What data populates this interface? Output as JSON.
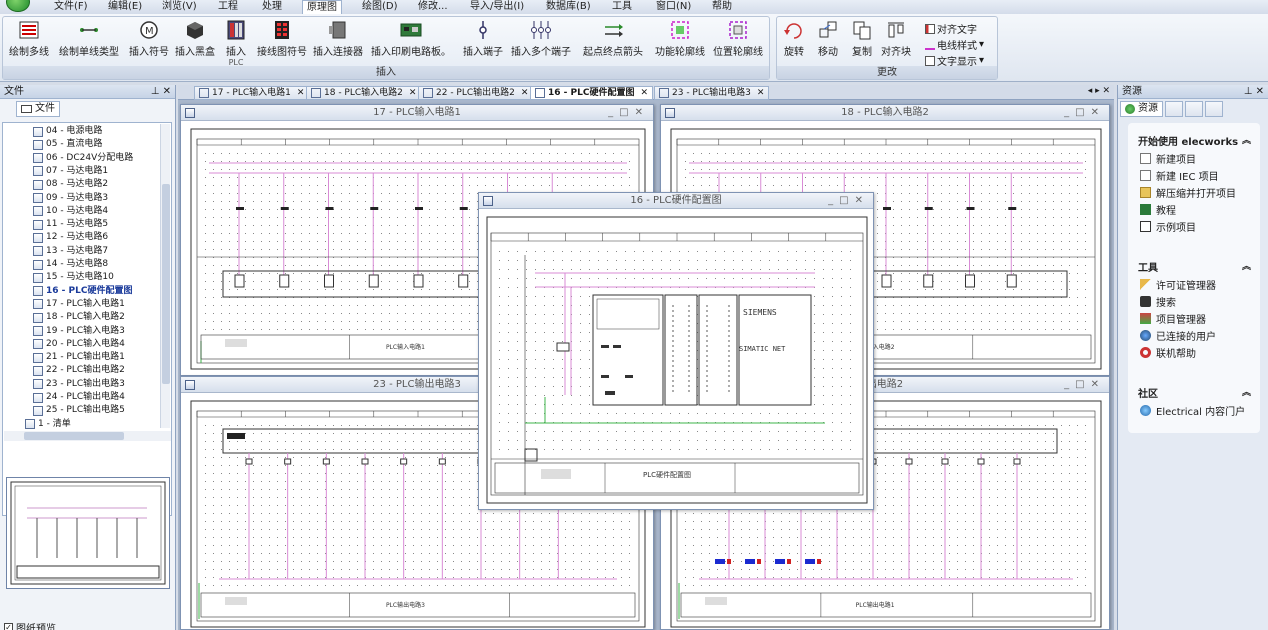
{
  "menu": {
    "items": [
      "文件(F)",
      "编辑(E)",
      "浏览(V)",
      "工程",
      "处理",
      "原理图",
      "绘图(D)",
      "修改...",
      "导入/导出(I)",
      "数据库(B)",
      "工具",
      "窗口(N)",
      "帮助"
    ],
    "active": "原理图"
  },
  "ribbon": {
    "buttons": {
      "draw_multiline": "绘制多线",
      "draw_singleline": "绘制单线类型",
      "insert_symbol": "插入符号",
      "insert_blackbox": "插入黑盒",
      "insert_plc": "插入",
      "insert_plc_sub": "PLC",
      "wiring_symbol": "接线图符号",
      "insert_connector": "插入连接器",
      "insert_pcb": "插入印刷电路板。",
      "insert_terminal": "插入端子",
      "insert_multi_terminal": "插入多个端子",
      "origin_dest_arrow": "起点终点箭头",
      "function_outline": "功能轮廓线",
      "location_outline": "位置轮廓线",
      "rotate": "旋转",
      "move": "移动",
      "copy": "复制",
      "align_block": "对齐块",
      "align_text": "对齐文字",
      "wire_style": "电线样式",
      "text_display": "文字显示"
    },
    "group_insert": "插入",
    "group_modify": "更改"
  },
  "left_panel": {
    "title": "文件",
    "tab": "文件",
    "tree_items": [
      {
        "label": "04 - 电源电路",
        "bold": false
      },
      {
        "label": "05 - 直流电路",
        "bold": false
      },
      {
        "label": "06 - DC24V分配电路",
        "bold": false
      },
      {
        "label": "07 - 马达电路1",
        "bold": false
      },
      {
        "label": "08 - 马达电路2",
        "bold": false
      },
      {
        "label": "09 - 马达电路3",
        "bold": false
      },
      {
        "label": "10 - 马达电路4",
        "bold": false
      },
      {
        "label": "11 - 马达电路5",
        "bold": false
      },
      {
        "label": "12 - 马达电路6",
        "bold": false
      },
      {
        "label": "13 - 马达电路7",
        "bold": false
      },
      {
        "label": "14 - 马达电路8",
        "bold": false
      },
      {
        "label": "15 - 马达电路10",
        "bold": false
      },
      {
        "label": "16 - PLC硬件配置图",
        "bold": true
      },
      {
        "label": "17 - PLC输入电路1",
        "bold": false
      },
      {
        "label": "18 - PLC输入电路2",
        "bold": false
      },
      {
        "label": "19 - PLC输入电路3",
        "bold": false
      },
      {
        "label": "20 - PLC输入电路4",
        "bold": false
      },
      {
        "label": "21 - PLC输出电路1",
        "bold": false
      },
      {
        "label": "22 - PLC输出电路2",
        "bold": false
      },
      {
        "label": "23 - PLC输出电路3",
        "bold": false
      },
      {
        "label": "24 - PLC输出电路4",
        "bold": false
      },
      {
        "label": "25 - PLC输出电路5",
        "bold": false
      },
      {
        "label": "1 - 清单",
        "bold": false
      }
    ],
    "preview_label": "图纸预览"
  },
  "doc_tabs": [
    {
      "label": "17 - PLC输入电路1",
      "active": false
    },
    {
      "label": "18 - PLC输入电路2",
      "active": false
    },
    {
      "label": "22 - PLC输出电路2",
      "active": false
    },
    {
      "label": "16 - PLC硬件配置图",
      "active": true
    },
    {
      "label": "23 - PLC输出电路3",
      "active": false
    }
  ],
  "windows": {
    "w17": {
      "title": "17 - PLC输入电路1",
      "caption": "PLC输入电路1"
    },
    "w18": {
      "title": "18 - PLC输入电路2",
      "caption": "PLC输入电路2"
    },
    "w23": {
      "title": "23 - PLC输出电路3",
      "caption": "PLC输出电路3"
    },
    "w22": {
      "title": "出电路2",
      "caption": "PLC输出电路1"
    },
    "w16": {
      "title": "16 - PLC硬件配置图",
      "caption": "PLC硬件配置图",
      "siemens": "SIEMENS",
      "simatic": "SIMATIC NET"
    }
  },
  "right_panel": {
    "title": "资源",
    "tab": "资源",
    "start_title": "开始使用 elecworks",
    "start_items": [
      "新建项目",
      "新建 IEC 项目",
      "解压缩并打开项目",
      "教程",
      "示例项目"
    ],
    "tools_title": "工具",
    "tools_items": [
      "许可证管理器",
      "搜索",
      "项目管理器",
      "已连接的用户",
      "联机帮助"
    ],
    "community_title": "社区",
    "community_items": [
      "Electrical 内容门户"
    ]
  },
  "colors": {
    "accent": "#1a3a9a",
    "wire_pink": "#d98bd6",
    "wire_green": "#3cb54a"
  }
}
